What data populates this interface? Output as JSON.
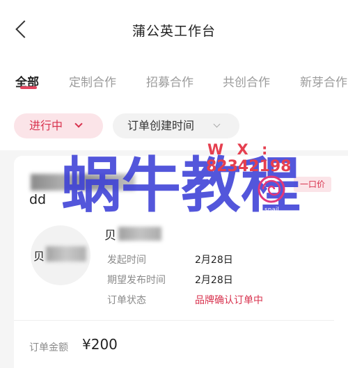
{
  "header": {
    "title": "蒲公英工作台"
  },
  "tabs": [
    {
      "label": "全部",
      "active": true
    },
    {
      "label": "定制合作"
    },
    {
      "label": "招募合作"
    },
    {
      "label": "共创合作"
    },
    {
      "label": "新芽合作"
    }
  ],
  "filters": {
    "status": "进行中",
    "sort": "订单创建时间"
  },
  "order": {
    "name": "dd",
    "badge": "一口价",
    "avatar_text": "贝",
    "brand_prefix": "贝",
    "fields": [
      {
        "label": "发起时间",
        "value": "2月28日"
      },
      {
        "label": "期望发布时间",
        "value": "2月28日"
      },
      {
        "label": "订单状态",
        "value": "品牌确认订单中"
      }
    ],
    "amount_label": "订单金额",
    "amount": "¥200"
  },
  "watermark": {
    "title": "蜗牛教程",
    "wx": "W X :",
    "number": "82342198",
    "small": "snail",
    "colors": {
      "blue": "#3b3fd6",
      "pink": "#e2387a",
      "red": "#e53f4f"
    }
  },
  "icons": {
    "back": "chevron-left-icon",
    "status_caret": "chevron-down-icon",
    "sort_caret": "chevron-down-icon"
  },
  "colors": {
    "accent": "#e2455f",
    "chip_bg": "#fbe4e8"
  }
}
